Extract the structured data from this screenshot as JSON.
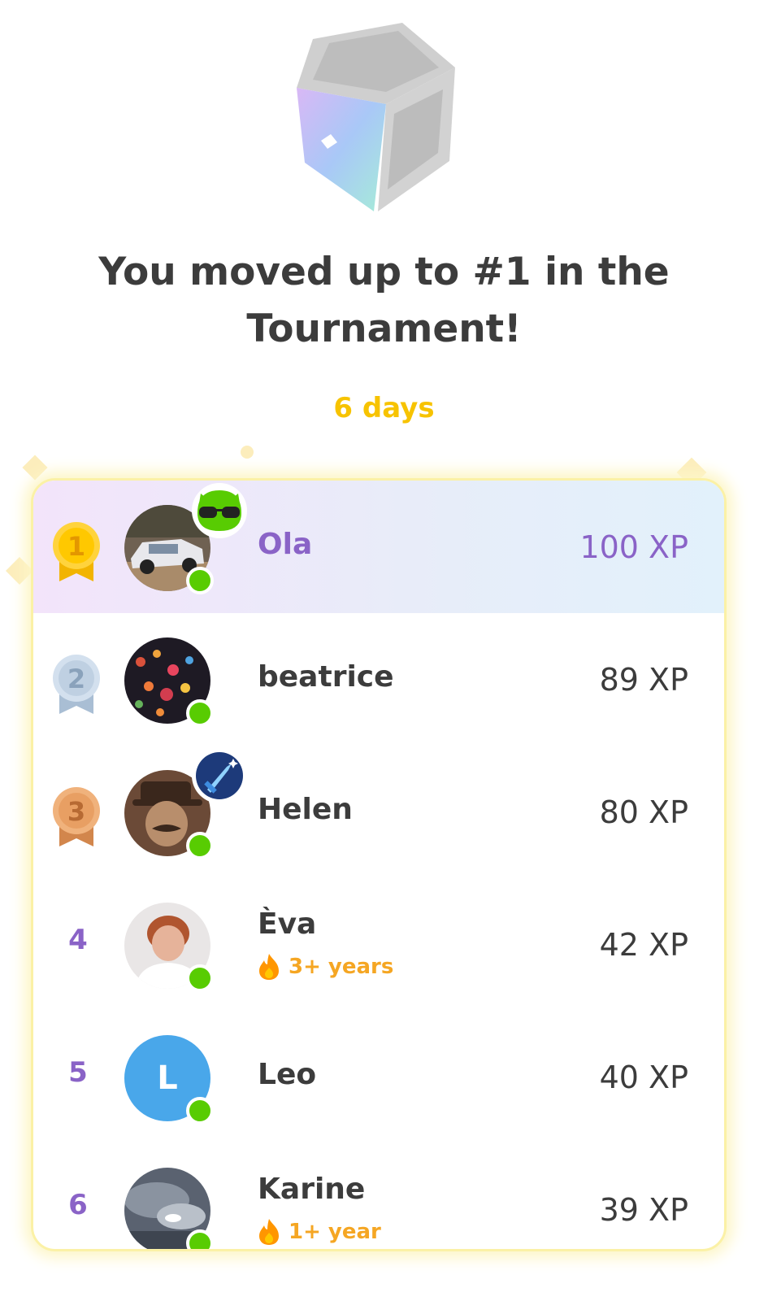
{
  "header": {
    "title": "You moved up to #1 in the Tournament!",
    "time_left": "6 days"
  },
  "colors": {
    "accent_purple": "#8a63c7",
    "gold": "#f7c300",
    "online_green": "#58cc02",
    "streak_orange": "#f5a623"
  },
  "leaderboard": [
    {
      "rank": "1",
      "medal": "gold-medal-icon",
      "name": "Ola",
      "xp": "100 XP",
      "badge": "sunglasses-owl-icon",
      "highlighted": true
    },
    {
      "rank": "2",
      "medal": "silver-medal-icon",
      "name": "beatrice",
      "xp": "89 XP"
    },
    {
      "rank": "3",
      "medal": "bronze-medal-icon",
      "name": "Helen",
      "xp": "80 XP",
      "badge": "sword-icon"
    },
    {
      "rank": "4",
      "name": "Èva",
      "streak": "3+ years",
      "xp": "42 XP"
    },
    {
      "rank": "5",
      "name": "Leo",
      "avatar_letter": "L",
      "xp": "40 XP"
    },
    {
      "rank": "6",
      "name": "Karine",
      "streak": "1+ year",
      "xp": "39 XP"
    }
  ]
}
